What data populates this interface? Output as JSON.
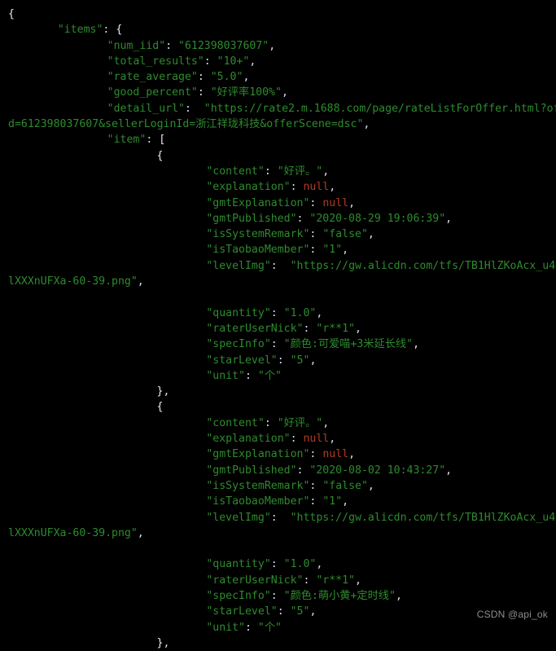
{
  "view": {
    "kind": "json-code-block",
    "background": "#000000",
    "key_color": "#2e8b2e",
    "string_color": "#2e8b2e",
    "null_color": "#b23a24",
    "punctuation_color": "#dcdcf0",
    "brace_color": "#e8e8f4",
    "watermark_color": "#8d8d8d"
  },
  "watermark": "CSDN @api_ok",
  "json": {
    "items": {
      "num_iid": "612398037607",
      "total_results": "10+",
      "rate_average": "5.0",
      "good_percent": "好评率100%",
      "detail_url": "https://rate2.m.1688.com/page/rateListForOffer.html?offerId=612398037607&sellerLoginId=浙江祥珑科技&offerScene=dsc",
      "item": [
        {
          "content": "好评。",
          "explanation": null,
          "gmtExplanation": null,
          "gmtPublished": "2020-08-29 19:06:39",
          "isSystemRemark": "false",
          "isTaobaoMember": "1",
          "levelImg": "https://gw.alicdn.com/tfs/TB1HlZKoAcx_u4jSZFlXXXnUFXa-60-39.png",
          "quantity": "1.0",
          "raterUserNick": "r**1",
          "specInfo": "颜色:可爱喵+3米延长线",
          "starLevel": "5",
          "unit": "个"
        },
        {
          "content": "好评。",
          "explanation": null,
          "gmtExplanation": null,
          "gmtPublished": "2020-08-02 10:43:27",
          "isSystemRemark": "false",
          "isTaobaoMember": "1",
          "levelImg": "https://gw.alicdn.com/tfs/TB1HlZKoAcx_u4jSZFlXXXnUFXa-60-39.png",
          "quantity": "1.0",
          "raterUserNick": "r**1",
          "specInfo": "颜色:萌小黄+定时线",
          "starLevel": "5",
          "unit": "个"
        }
      ]
    }
  },
  "lines": [
    {
      "id": "l01",
      "indent": 0,
      "tokens": [
        {
          "t": "{",
          "c": "b"
        }
      ]
    },
    {
      "id": "l02",
      "indent": 1,
      "tokens": [
        {
          "t": "\"items\"",
          "c": "k"
        },
        {
          "t": ":",
          "c": "p"
        },
        {
          "t": " ",
          "c": "p"
        },
        {
          "t": "{",
          "c": "b"
        }
      ]
    },
    {
      "id": "l03",
      "indent": 2,
      "tokens": [
        {
          "t": "\"num_iid\"",
          "c": "k"
        },
        {
          "t": ":",
          "c": "p"
        },
        {
          "t": " ",
          "c": "p"
        },
        {
          "t": "\"612398037607\"",
          "c": "s"
        },
        {
          "t": ",",
          "c": "p"
        }
      ]
    },
    {
      "id": "l04",
      "indent": 2,
      "tokens": [
        {
          "t": "\"total_results\"",
          "c": "k"
        },
        {
          "t": ":",
          "c": "p"
        },
        {
          "t": " ",
          "c": "p"
        },
        {
          "t": "\"10+\"",
          "c": "s"
        },
        {
          "t": ",",
          "c": "p"
        }
      ]
    },
    {
      "id": "l05",
      "indent": 2,
      "tokens": [
        {
          "t": "\"rate_average\"",
          "c": "k"
        },
        {
          "t": ":",
          "c": "p"
        },
        {
          "t": " ",
          "c": "p"
        },
        {
          "t": "\"5.0\"",
          "c": "s"
        },
        {
          "t": ",",
          "c": "p"
        }
      ]
    },
    {
      "id": "l06",
      "indent": 2,
      "tokens": [
        {
          "t": "\"good_percent\"",
          "c": "k"
        },
        {
          "t": ":",
          "c": "p"
        },
        {
          "t": " ",
          "c": "p"
        },
        {
          "t": "\"好评率100%\"",
          "c": "s"
        },
        {
          "t": ",",
          "c": "p"
        }
      ]
    },
    {
      "id": "l07",
      "indent": 2,
      "tokens": [
        {
          "t": "\"detail_url\"",
          "c": "k"
        },
        {
          "t": ":",
          "c": "p"
        },
        {
          "t": "  ",
          "c": "p"
        },
        {
          "t": "\"https://rate2.m.1688.com/page/rateListForOffer.html?offerI",
          "c": "s"
        }
      ]
    },
    {
      "id": "l08",
      "indent": -1,
      "tokens": [
        {
          "t": "d=612398037607&sellerLoginId=浙江祥珑科技&offerScene=dsc\"",
          "c": "s"
        },
        {
          "t": ",",
          "c": "p"
        }
      ]
    },
    {
      "id": "l09",
      "indent": 2,
      "tokens": [
        {
          "t": "\"item\"",
          "c": "k"
        },
        {
          "t": ":",
          "c": "p"
        },
        {
          "t": " ",
          "c": "p"
        },
        {
          "t": "[",
          "c": "b"
        }
      ]
    },
    {
      "id": "l10",
      "indent": 3,
      "tokens": [
        {
          "t": "{",
          "c": "b"
        }
      ]
    },
    {
      "id": "l11",
      "indent": 4,
      "tokens": [
        {
          "t": "\"content\"",
          "c": "k"
        },
        {
          "t": ":",
          "c": "p"
        },
        {
          "t": " ",
          "c": "p"
        },
        {
          "t": "\"好评。\"",
          "c": "s"
        },
        {
          "t": ",",
          "c": "p"
        }
      ]
    },
    {
      "id": "l12",
      "indent": 4,
      "tokens": [
        {
          "t": "\"explanation\"",
          "c": "k"
        },
        {
          "t": ":",
          "c": "p"
        },
        {
          "t": " ",
          "c": "p"
        },
        {
          "t": "null",
          "c": "nul"
        },
        {
          "t": ",",
          "c": "p"
        }
      ]
    },
    {
      "id": "l13",
      "indent": 4,
      "tokens": [
        {
          "t": "\"gmtExplanation\"",
          "c": "k"
        },
        {
          "t": ":",
          "c": "p"
        },
        {
          "t": " ",
          "c": "p"
        },
        {
          "t": "null",
          "c": "nul"
        },
        {
          "t": ",",
          "c": "p"
        }
      ]
    },
    {
      "id": "l14",
      "indent": 4,
      "tokens": [
        {
          "t": "\"gmtPublished\"",
          "c": "k"
        },
        {
          "t": ":",
          "c": "p"
        },
        {
          "t": " ",
          "c": "p"
        },
        {
          "t": "\"2020-08-29 19:06:39\"",
          "c": "s"
        },
        {
          "t": ",",
          "c": "p"
        }
      ]
    },
    {
      "id": "l15",
      "indent": 4,
      "tokens": [
        {
          "t": "\"isSystemRemark\"",
          "c": "k"
        },
        {
          "t": ":",
          "c": "p"
        },
        {
          "t": " ",
          "c": "p"
        },
        {
          "t": "\"false\"",
          "c": "s"
        },
        {
          "t": ",",
          "c": "p"
        }
      ]
    },
    {
      "id": "l16",
      "indent": 4,
      "tokens": [
        {
          "t": "\"isTaobaoMember\"",
          "c": "k"
        },
        {
          "t": ":",
          "c": "p"
        },
        {
          "t": " ",
          "c": "p"
        },
        {
          "t": "\"1\"",
          "c": "s"
        },
        {
          "t": ",",
          "c": "p"
        }
      ]
    },
    {
      "id": "l17",
      "indent": 4,
      "tokens": [
        {
          "t": "\"levelImg\"",
          "c": "k"
        },
        {
          "t": ":",
          "c": "p"
        },
        {
          "t": "  ",
          "c": "p"
        },
        {
          "t": "\"https://gw.alicdn.com/tfs/TB1HlZKoAcx_u4jSZF",
          "c": "s"
        }
      ]
    },
    {
      "id": "l18",
      "indent": -1,
      "tokens": [
        {
          "t": "lXXXnUFXa-60-39.png\"",
          "c": "s"
        },
        {
          "t": ",",
          "c": "p"
        }
      ]
    },
    {
      "id": "l19",
      "indent": -2,
      "tokens": []
    },
    {
      "id": "l20",
      "indent": 4,
      "tokens": [
        {
          "t": "\"quantity\"",
          "c": "k"
        },
        {
          "t": ":",
          "c": "p"
        },
        {
          "t": " ",
          "c": "p"
        },
        {
          "t": "\"1.0\"",
          "c": "s"
        },
        {
          "t": ",",
          "c": "p"
        }
      ]
    },
    {
      "id": "l21",
      "indent": 4,
      "tokens": [
        {
          "t": "\"raterUserNick\"",
          "c": "k"
        },
        {
          "t": ":",
          "c": "p"
        },
        {
          "t": " ",
          "c": "p"
        },
        {
          "t": "\"r**1\"",
          "c": "s"
        },
        {
          "t": ",",
          "c": "p"
        }
      ]
    },
    {
      "id": "l22",
      "indent": 4,
      "tokens": [
        {
          "t": "\"specInfo\"",
          "c": "k"
        },
        {
          "t": ":",
          "c": "p"
        },
        {
          "t": " ",
          "c": "p"
        },
        {
          "t": "\"颜色:可爱喵+3米延长线\"",
          "c": "s"
        },
        {
          "t": ",",
          "c": "p"
        }
      ]
    },
    {
      "id": "l23",
      "indent": 4,
      "tokens": [
        {
          "t": "\"starLevel\"",
          "c": "k"
        },
        {
          "t": ":",
          "c": "p"
        },
        {
          "t": " ",
          "c": "p"
        },
        {
          "t": "\"5\"",
          "c": "s"
        },
        {
          "t": ",",
          "c": "p"
        }
      ]
    },
    {
      "id": "l24",
      "indent": 4,
      "tokens": [
        {
          "t": "\"unit\"",
          "c": "k"
        },
        {
          "t": ":",
          "c": "p"
        },
        {
          "t": " ",
          "c": "p"
        },
        {
          "t": "\"个\"",
          "c": "s"
        }
      ]
    },
    {
      "id": "l25",
      "indent": 3,
      "tokens": [
        {
          "t": "}",
          "c": "b"
        },
        {
          "t": ",",
          "c": "p"
        }
      ]
    },
    {
      "id": "l26",
      "indent": 3,
      "tokens": [
        {
          "t": "{",
          "c": "b"
        }
      ]
    },
    {
      "id": "l27",
      "indent": 4,
      "tokens": [
        {
          "t": "\"content\"",
          "c": "k"
        },
        {
          "t": ":",
          "c": "p"
        },
        {
          "t": " ",
          "c": "p"
        },
        {
          "t": "\"好评。\"",
          "c": "s"
        },
        {
          "t": ",",
          "c": "p"
        }
      ]
    },
    {
      "id": "l28",
      "indent": 4,
      "tokens": [
        {
          "t": "\"explanation\"",
          "c": "k"
        },
        {
          "t": ":",
          "c": "p"
        },
        {
          "t": " ",
          "c": "p"
        },
        {
          "t": "null",
          "c": "nul"
        },
        {
          "t": ",",
          "c": "p"
        }
      ]
    },
    {
      "id": "l29",
      "indent": 4,
      "tokens": [
        {
          "t": "\"gmtExplanation\"",
          "c": "k"
        },
        {
          "t": ":",
          "c": "p"
        },
        {
          "t": " ",
          "c": "p"
        },
        {
          "t": "null",
          "c": "nul"
        },
        {
          "t": ",",
          "c": "p"
        }
      ]
    },
    {
      "id": "l30",
      "indent": 4,
      "tokens": [
        {
          "t": "\"gmtPublished\"",
          "c": "k"
        },
        {
          "t": ":",
          "c": "p"
        },
        {
          "t": " ",
          "c": "p"
        },
        {
          "t": "\"2020-08-02 10:43:27\"",
          "c": "s"
        },
        {
          "t": ",",
          "c": "p"
        }
      ]
    },
    {
      "id": "l31",
      "indent": 4,
      "tokens": [
        {
          "t": "\"isSystemRemark\"",
          "c": "k"
        },
        {
          "t": ":",
          "c": "p"
        },
        {
          "t": " ",
          "c": "p"
        },
        {
          "t": "\"false\"",
          "c": "s"
        },
        {
          "t": ",",
          "c": "p"
        }
      ]
    },
    {
      "id": "l32",
      "indent": 4,
      "tokens": [
        {
          "t": "\"isTaobaoMember\"",
          "c": "k"
        },
        {
          "t": ":",
          "c": "p"
        },
        {
          "t": " ",
          "c": "p"
        },
        {
          "t": "\"1\"",
          "c": "s"
        },
        {
          "t": ",",
          "c": "p"
        }
      ]
    },
    {
      "id": "l33",
      "indent": 4,
      "tokens": [
        {
          "t": "\"levelImg\"",
          "c": "k"
        },
        {
          "t": ":",
          "c": "p"
        },
        {
          "t": "  ",
          "c": "p"
        },
        {
          "t": "\"https://gw.alicdn.com/tfs/TB1HlZKoAcx_u4jSZF",
          "c": "s"
        }
      ]
    },
    {
      "id": "l34",
      "indent": -1,
      "tokens": [
        {
          "t": "lXXXnUFXa-60-39.png\"",
          "c": "s"
        },
        {
          "t": ",",
          "c": "p"
        }
      ]
    },
    {
      "id": "l35",
      "indent": -2,
      "tokens": []
    },
    {
      "id": "l36",
      "indent": 4,
      "tokens": [
        {
          "t": "\"quantity\"",
          "c": "k"
        },
        {
          "t": ":",
          "c": "p"
        },
        {
          "t": " ",
          "c": "p"
        },
        {
          "t": "\"1.0\"",
          "c": "s"
        },
        {
          "t": ",",
          "c": "p"
        }
      ]
    },
    {
      "id": "l37",
      "indent": 4,
      "tokens": [
        {
          "t": "\"raterUserNick\"",
          "c": "k"
        },
        {
          "t": ":",
          "c": "p"
        },
        {
          "t": " ",
          "c": "p"
        },
        {
          "t": "\"r**1\"",
          "c": "s"
        },
        {
          "t": ",",
          "c": "p"
        }
      ]
    },
    {
      "id": "l38",
      "indent": 4,
      "tokens": [
        {
          "t": "\"specInfo\"",
          "c": "k"
        },
        {
          "t": ":",
          "c": "p"
        },
        {
          "t": " ",
          "c": "p"
        },
        {
          "t": "\"颜色:萌小黄+定时线\"",
          "c": "s"
        },
        {
          "t": ",",
          "c": "p"
        }
      ]
    },
    {
      "id": "l39",
      "indent": 4,
      "tokens": [
        {
          "t": "\"starLevel\"",
          "c": "k"
        },
        {
          "t": ":",
          "c": "p"
        },
        {
          "t": " ",
          "c": "p"
        },
        {
          "t": "\"5\"",
          "c": "s"
        },
        {
          "t": ",",
          "c": "p"
        }
      ]
    },
    {
      "id": "l40",
      "indent": 4,
      "tokens": [
        {
          "t": "\"unit\"",
          "c": "k"
        },
        {
          "t": ":",
          "c": "p"
        },
        {
          "t": " ",
          "c": "p"
        },
        {
          "t": "\"个\"",
          "c": "s"
        }
      ]
    },
    {
      "id": "l41",
      "indent": 3,
      "tokens": [
        {
          "t": "}",
          "c": "b"
        },
        {
          "t": ",",
          "c": "p"
        }
      ]
    }
  ]
}
